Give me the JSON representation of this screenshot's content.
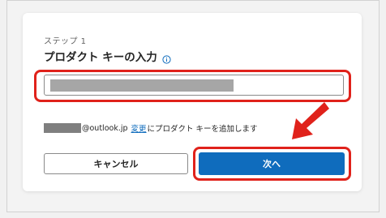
{
  "dialog": {
    "step_label": "ステップ 1",
    "title": "プロダクト キーの入力",
    "info_icon": "info-icon"
  },
  "product_key_input": {
    "value": ""
  },
  "account": {
    "email_suffix": "@outlook.jp",
    "change_link": "変更",
    "description": "にプロダクト キーを追加します"
  },
  "buttons": {
    "cancel_label": "キャンセル",
    "next_label": "次へ"
  },
  "colors": {
    "accent": "#0f6cbd",
    "annotation": "#e0221b",
    "redaction": "#a6a6a6"
  }
}
